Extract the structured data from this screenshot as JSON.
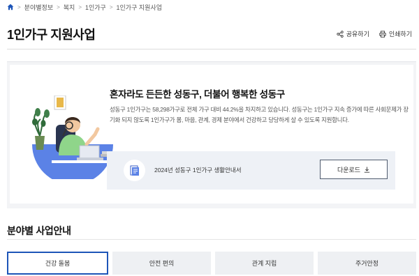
{
  "breadcrumb": {
    "items": [
      "분야별정보",
      "복지",
      "1인가구",
      "1인가구 지원사업"
    ]
  },
  "page_title": "1인가구 지원사업",
  "actions": {
    "share_label": "공유하기",
    "print_label": "인쇄하기"
  },
  "hero": {
    "headline": "혼자라도 든든한 성동구, 더불어 행복한 성동구",
    "description": "성동구 1인가구는 58,298가구로 전체 가구 대비 44.2%을 차지하고 있습니다. 성동구는 1인가구 지속 증가에 따른 사회문제가 장기화 되지 않도록 1인가구가 몸, 마음, 관계, 경제 분야에서 건강하고 당당하게 살 수 있도록 지원합니다.",
    "document_title": "2024년 성동구 1인가구 생활안내서",
    "download_label": "다운로드"
  },
  "section": {
    "title": "분야별 사업안내"
  },
  "tabs": [
    {
      "label": "건강 돌봄",
      "active": true
    },
    {
      "label": "안전 편의",
      "active": false
    },
    {
      "label": "관계 지립",
      "active": false
    },
    {
      "label": "주거안정",
      "active": false
    }
  ],
  "colors": {
    "accent": "#1d55b8",
    "tab_bg": "#eef0f3",
    "hero_bg": "#f3f4f6",
    "download_bar_bg": "#eef1f6"
  },
  "icons": {
    "home": "home-icon",
    "share": "share-icon",
    "print": "print-icon",
    "document": "document-icon",
    "download": "download-icon"
  }
}
